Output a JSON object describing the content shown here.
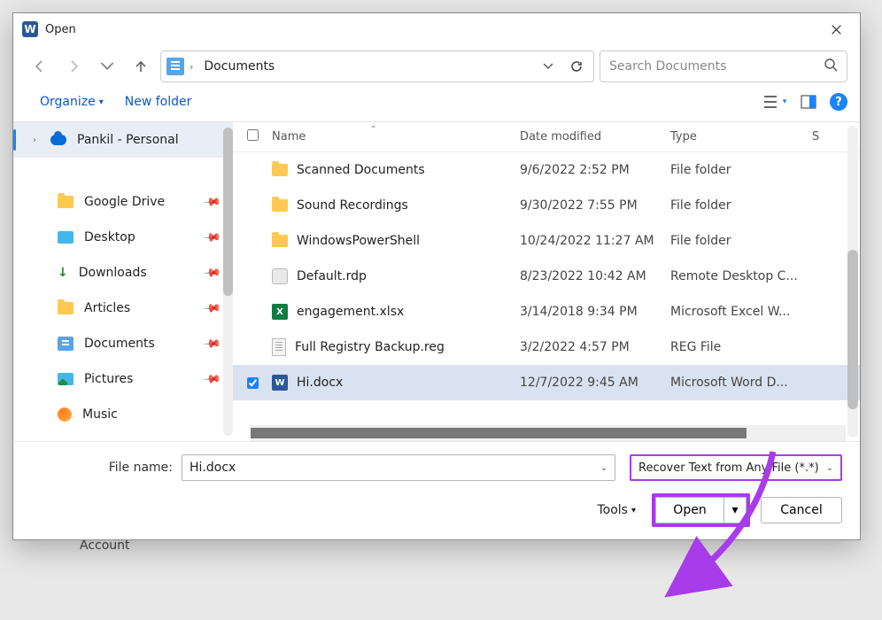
{
  "title": "Open",
  "breadcrumb": "Documents",
  "search": {
    "placeholder": "Search Documents"
  },
  "toolbar": {
    "organize": "Organize",
    "newFolder": "New folder"
  },
  "sidebar": {
    "cloud": "Pankil - Personal",
    "items": [
      {
        "label": "Google Drive"
      },
      {
        "label": "Desktop"
      },
      {
        "label": "Downloads"
      },
      {
        "label": "Articles"
      },
      {
        "label": "Documents"
      },
      {
        "label": "Pictures"
      },
      {
        "label": "Music"
      }
    ]
  },
  "columns": {
    "name": "Name",
    "date": "Date modified",
    "type": "Type",
    "size": "S"
  },
  "rows": [
    {
      "name": "Scanned Documents",
      "date": "9/6/2022 2:52 PM",
      "type": "File folder",
      "kind": "folder"
    },
    {
      "name": "Sound Recordings",
      "date": "9/30/2022 7:55 PM",
      "type": "File folder",
      "kind": "folder"
    },
    {
      "name": "WindowsPowerShell",
      "date": "10/24/2022 11:27 AM",
      "type": "File folder",
      "kind": "folder"
    },
    {
      "name": "Default.rdp",
      "date": "8/23/2022 10:42 AM",
      "type": "Remote Desktop C...",
      "kind": "rdp"
    },
    {
      "name": "engagement.xlsx",
      "date": "3/14/2018 9:34 PM",
      "type": "Microsoft Excel W...",
      "kind": "xlsx"
    },
    {
      "name": "Full Registry Backup.reg",
      "date": "3/2/2022 4:57 PM",
      "type": "REG File",
      "kind": "reg"
    },
    {
      "name": "Hi.docx",
      "date": "12/7/2022 9:45 AM",
      "type": "Microsoft Word D...",
      "kind": "docx",
      "selected": true
    }
  ],
  "footer": {
    "fileNameLabel": "File name:",
    "fileName": "Hi.docx",
    "filter": "Recover Text from Any File (*.*)",
    "tools": "Tools",
    "open": "Open",
    "cancel": "Cancel"
  },
  "behind": {
    "account": "Account"
  }
}
